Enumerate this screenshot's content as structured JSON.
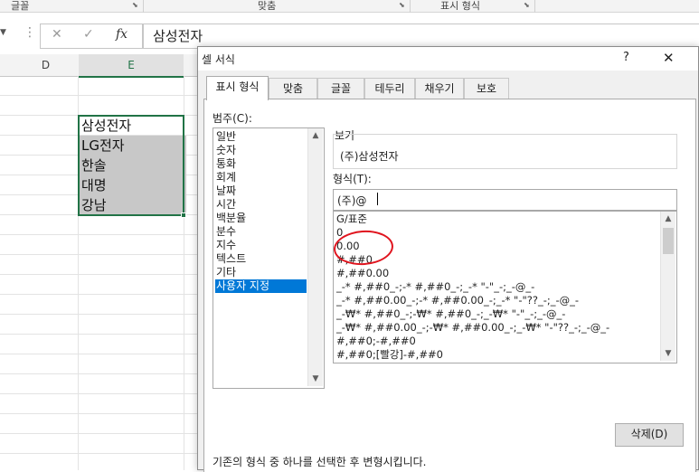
{
  "ribbon": {
    "groups": [
      "글꼴",
      "맞춤",
      "표시 형식"
    ]
  },
  "formula_bar": {
    "cancel_glyph": "✕",
    "enter_glyph": "✓",
    "fx_label": "fx",
    "content": "삼성전자"
  },
  "grid": {
    "columns": [
      "D",
      "E"
    ],
    "cells": [
      "삼성전자",
      "LG전자",
      "한솔",
      "대명",
      "강남"
    ]
  },
  "dialog": {
    "title": "셀 서식",
    "help": "?",
    "close": "✕",
    "tabs": [
      "표시 형식",
      "맞춤",
      "글꼴",
      "테두리",
      "채우기",
      "보호"
    ],
    "category_label": "범주(C):",
    "categories": [
      "일반",
      "숫자",
      "통화",
      "회계",
      "날짜",
      "시간",
      "백분율",
      "분수",
      "지수",
      "텍스트",
      "기타",
      "사용자 지정"
    ],
    "selected_category": "사용자 지정",
    "preview_label": "보기",
    "preview_value": "(주)삼성전자",
    "type_label": "형식(T):",
    "type_value": "(주)@",
    "formats": [
      "G/표준",
      "0",
      "0.00",
      "#,##0",
      "#,##0.00",
      "_-* #,##0_-;-* #,##0_-;_-* \"-\"_-;_-@_-",
      "_-* #,##0.00_-;-* #,##0.00_-;_-* \"-\"??_-;_-@_-",
      "_-₩* #,##0_-;-₩* #,##0_-;_-₩* \"-\"_-;_-@_-",
      "_-₩* #,##0.00_-;-₩* #,##0.00_-;_-₩* \"-\"??_-;_-@_-",
      "#,##0;-#,##0",
      "#,##0;[빨강]-#,##0"
    ],
    "delete_button": "삭제(D)",
    "description": "기존의 형식 중 하나를 선택한 후 변형시킵니다."
  },
  "colors": {
    "excel_green": "#217346",
    "selection_blue": "#0078d7",
    "annotation_red": "#e0141e"
  }
}
